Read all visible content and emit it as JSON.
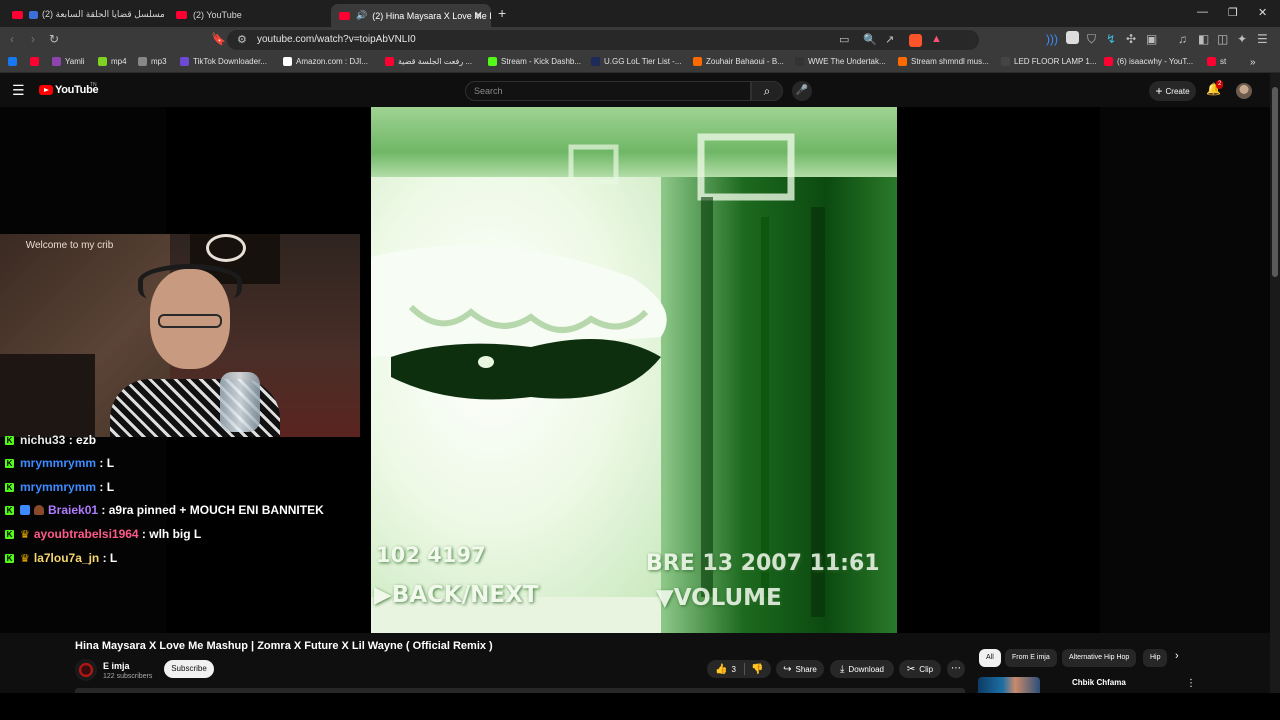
{
  "browser": {
    "tabs": [
      {
        "label": "مسلسل قضايا الحلقة السابعة (2)",
        "prefix": "e"
      },
      {
        "label": "(2) YouTube"
      },
      {
        "label": "(2) Hina Maysara X Love Me I",
        "active": true
      }
    ],
    "new_tab_symbol": "+",
    "window_controls": [
      "—",
      "❐",
      "✕"
    ],
    "url": "youtube.com/watch?v=toipAbVNLI0",
    "bookmarks": [
      {
        "label": "",
        "color": "#1877f2"
      },
      {
        "label": "",
        "color": "#ff0033"
      },
      {
        "label": "Yamli",
        "color": "#8e44ad"
      },
      {
        "label": "mp4",
        "color": "#7ed321"
      },
      {
        "label": "mp3",
        "color": "#888888"
      },
      {
        "label": "TikTok Downloader...",
        "color": "#6c4ad4"
      },
      {
        "label": "Amazon.com : DJI...",
        "color": "#ffffff"
      },
      {
        "label": "رفعت الجلسة قضية ...",
        "color": "#ff0033"
      },
      {
        "label": "Stream - Kick Dashb...",
        "color": "#53fc18"
      },
      {
        "label": "U.GG LoL Tier List -...",
        "color": "#1e2a5a"
      },
      {
        "label": "Zouhair Bahaoui - B...",
        "color": "#ff6a00"
      },
      {
        "label": "WWE The Undertak...",
        "color": "#333333"
      },
      {
        "label": "Stream shmndl mus...",
        "color": "#ff6a00"
      },
      {
        "label": "LED FLOOR LAMP 1...",
        "color": "#444444"
      },
      {
        "label": "(6) isaacwhy - YouT...",
        "color": "#ff0033"
      },
      {
        "label": "st",
        "color": "#ff0033"
      }
    ]
  },
  "youtube": {
    "logo_text": "YouTube",
    "logo_tm": "TN",
    "search_placeholder": "Search",
    "create_label": "Create",
    "notifications_count": "2",
    "video_title": "Hina Maysara X Love Me Mashup | Zomra X Future X Lil Wayne ( Official Remix )",
    "channel_name": "E imja",
    "subscribers": "122 subscribers",
    "subscribe_label": "Subscribe",
    "like_count": "3",
    "share_label": "Share",
    "download_label": "Download",
    "clip_label": "Clip",
    "chips": [
      "All",
      "From E imja",
      "Alternative Hip Hop",
      "Hip"
    ],
    "rec_title": "Chbik Chfama"
  },
  "video": {
    "osd_bottom_left": "102 4197",
    "osd_date": "BRE 13 2007  11:61",
    "osd_back_next": "▶BACK/NEXT",
    "osd_volume": "▼VOLUME"
  },
  "stream": {
    "webcam_sign": "Welcome to my crib",
    "chat": [
      {
        "user": "nichu33",
        "text": "ezb",
        "color": "#e8e8e8",
        "badges": []
      },
      {
        "user": "mrymmrymm",
        "text": "L",
        "color": "#3d8bff",
        "badges": []
      },
      {
        "user": "mrymmrymm",
        "text": "L",
        "color": "#3d8bff",
        "badges": []
      },
      {
        "user": "Braiek01",
        "text": "a9ra pinned + MOUCH ENI BANNITEK",
        "color": "#b07cff",
        "badges": [
          "blue",
          "hat"
        ]
      },
      {
        "user": "ayoubtrabelsi1964",
        "text": "wlh big L",
        "color": "#ff5a8a",
        "badges": [
          "crown"
        ]
      },
      {
        "user": "la7lou7a_jn",
        "text": "L",
        "color": "#f5d76e",
        "badges": [
          "crown"
        ]
      }
    ]
  }
}
